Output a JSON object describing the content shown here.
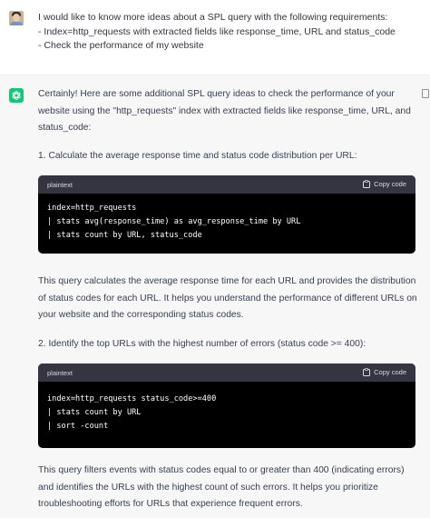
{
  "user": {
    "lines": [
      "I would like to know more ideas about a SPL query with the following requirements:",
      "- Index=http_requests with extracted fields like response_time, URL and status_code",
      "- Check the performance of my website"
    ]
  },
  "assistant": {
    "intro_lines": [
      "Certainly! Here are some additional SPL query ideas to check the performance of your",
      "website using the \"http_requests\" index with extracted fields like response_time, URL, and",
      "status_code:"
    ],
    "item1": "1.  Calculate the average response time and status code distribution per URL:",
    "code1": {
      "lang": "plaintext",
      "copy_label": "Copy code",
      "lines": [
        "index=http_requests",
        "| stats avg(response_time) as avg_response_time by URL",
        "| stats count by URL, status_code"
      ]
    },
    "explain1_lines": [
      "This query calculates the average response time for each URL and provides the distribution",
      "of status codes for each URL. It helps you understand the performance of different URLs on",
      "your website and the corresponding status codes."
    ],
    "item2": "2.  Identify the top URLs with the highest number of errors (status code >= 400):",
    "code2": {
      "lang": "plaintext",
      "copy_label": "Copy code",
      "lines": [
        "index=http_requests status_code>=400",
        "| stats count by URL",
        "| sort -count"
      ]
    },
    "explain2_lines": [
      "This query filters events with status codes equal to or greater than 400 (indicating errors)",
      "and identifies the URLs with the highest count of such errors. It helps you prioritize",
      "troubleshooting efforts for URLs that experience frequent errors."
    ]
  },
  "icons": {
    "assistant_avatar": "openai-logo-icon",
    "user_avatar": "user-photo-avatar",
    "copy": "clipboard-icon"
  },
  "colors": {
    "assistant_bg": "#f7f7f8",
    "gpt_green": "#19c37d",
    "code_bg": "#000000",
    "code_header_bg": "#343541"
  }
}
